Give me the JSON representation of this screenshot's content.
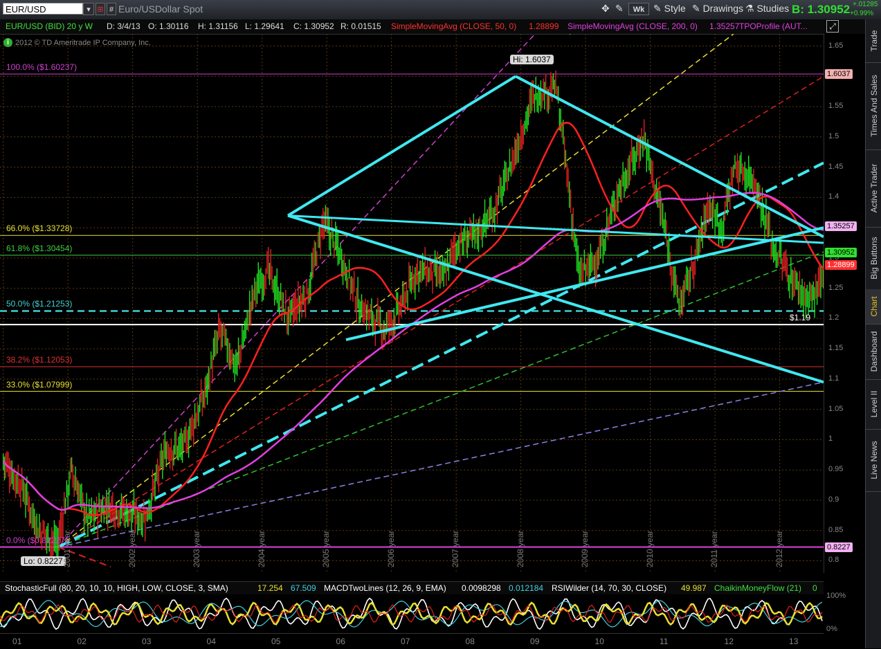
{
  "toolbar": {
    "symbol": "EUR/USD",
    "hash_label": "#",
    "description": "Euro/USDollar Spot",
    "wk_label": "Wk",
    "style_label": "Style",
    "drawings_label": "Drawings",
    "studies_label": "Studies",
    "bid": "B: 1.30952",
    "change_abs": "+.01285",
    "change_pct": "+0.99%"
  },
  "header": {
    "instrument": "EUR/USD (BID) 20 y W",
    "date": "D: 3/4/13",
    "open": "O: 1.30116",
    "high": "H: 1.31156",
    "low": "L: 1.29641",
    "close": "C: 1.30952",
    "range": "R: 0.01515",
    "sma50_label": "SimpleMovingAvg (CLOSE, 50, 0)",
    "sma50_value": "1.28899",
    "sma200_label": "SimpleMovingAvg (CLOSE, 200, 0)",
    "sma200_value": "1.35257",
    "tpo_label": "TPOProfile (AUT..."
  },
  "copyright": "2012 © TD Ameritrade IP Company, Inc.",
  "annotations": {
    "hi": "Hi: 1.6037",
    "lo": "Lo: 0.8227",
    "level_119": "$1.19"
  },
  "fib_levels": [
    {
      "label": "100.0%  ($1.60237)",
      "price": 1.6037,
      "color": "#d040d0"
    },
    {
      "label": "66.0%  ($1.33728)",
      "price": 1.3373,
      "color": "#e8e030"
    },
    {
      "label": "61.8%  ($1.30454)",
      "price": 1.3045,
      "color": "#40d040"
    },
    {
      "label": "50.0%  ($1.21253)",
      "price": 1.2125,
      "color": "#40d0d0"
    },
    {
      "label": "38.2%  ($1.12053)",
      "price": 1.1205,
      "color": "#e03030"
    },
    {
      "label": "33.0%  ($1.07999)",
      "price": 1.0799,
      "color": "#e8e030"
    },
    {
      "label": "0.0%  ($0.82227)",
      "price": 0.8227,
      "color": "#d040d0"
    }
  ],
  "y_axis": {
    "min": 0.78,
    "max": 1.67,
    "ticks": [
      "1.65",
      "1.6",
      "1.55",
      "1.5",
      "1.45",
      "1.4",
      "1.35",
      "1.3",
      "1.25",
      "1.2",
      "1.15",
      "1.1",
      "1.05",
      "1",
      "0.95",
      "0.9",
      "0.85",
      "0.8"
    ]
  },
  "price_tags": [
    {
      "text": "1.6037",
      "price": 1.6037,
      "bg": "#f4b0b0",
      "fg": "#000"
    },
    {
      "text": "1.35257",
      "price": 1.3525,
      "bg": "#f0b0f0",
      "fg": "#000"
    },
    {
      "text": "1.30952",
      "price": 1.3095,
      "bg": "#30e030",
      "fg": "#000"
    },
    {
      "text": "1.28899",
      "price": 1.2889,
      "bg": "#ff3030",
      "fg": "#fff"
    },
    {
      "text": "0.8227",
      "price": 0.8227,
      "bg": "#f4b0f4",
      "fg": "#000"
    }
  ],
  "year_labels": [
    "2001 year",
    "2002 year",
    "2003 year",
    "2004 year",
    "2005 year",
    "2006 year",
    "2007 year",
    "2008 year",
    "2009 year",
    "2010 year",
    "2011 year",
    "2012 year"
  ],
  "x_axis": [
    "01",
    "02",
    "03",
    "04",
    "05",
    "06",
    "07",
    "08",
    "09",
    "10",
    "11",
    "12",
    "13"
  ],
  "lower": {
    "stoch_label": "StochasticFull (80, 20, 10, 10, HIGH, LOW, CLOSE, 3, SMA)",
    "stoch_v1": "17.254",
    "stoch_v2": "67.509",
    "macd_label": "MACDTwoLines (12, 26, 9, EMA)",
    "macd_v1": "0.0098298",
    "macd_v2": "0.012184",
    "rsi_label": "RSIWilder (14, 70, 30, CLOSE)",
    "rsi_v": "49.987",
    "cmf_label": "ChaikinMoneyFlow (21)",
    "cmf_v": "0",
    "pct_top": "100%",
    "pct_bot": "0%"
  },
  "sidebar": [
    "Trade",
    "Times And Sales",
    "Active Trader",
    "Big Buttons",
    "Chart",
    "Dashboard",
    "Level II",
    "Live News"
  ],
  "colors": {
    "sma50": "#ff2020",
    "sma200": "#e040e0",
    "trend": "#40e8f0",
    "up": "#20e020",
    "down": "#e02020"
  }
}
